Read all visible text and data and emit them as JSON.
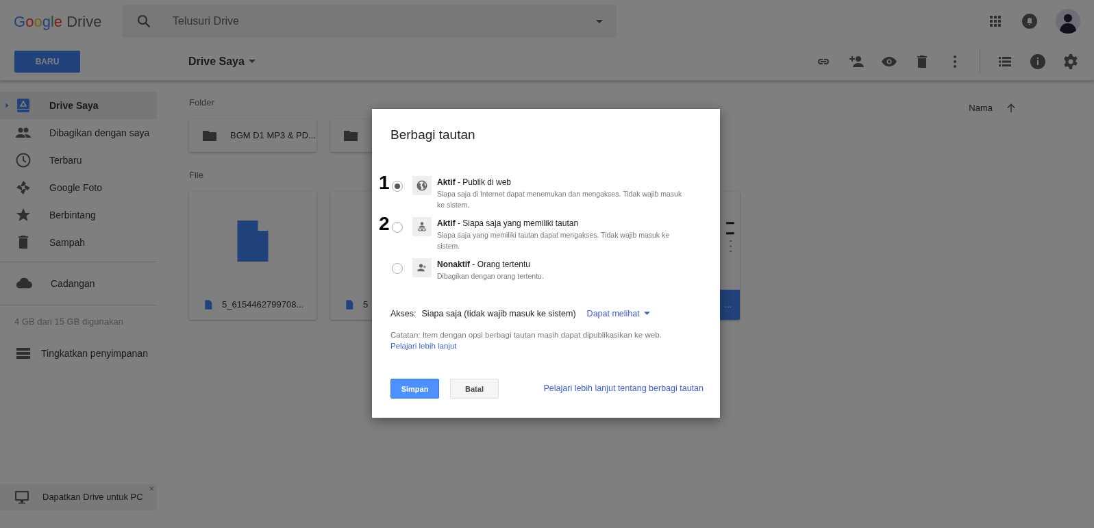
{
  "header": {
    "logo_brand": "Google",
    "logo_product": "Drive",
    "search": {
      "placeholder": "Telusuri Drive"
    }
  },
  "new_button": "BARU",
  "location": {
    "title": "Drive Saya"
  },
  "sidebar": {
    "items": [
      {
        "label": "Drive Saya",
        "selected": true
      },
      {
        "label": "Dibagikan dengan saya",
        "selected": false
      },
      {
        "label": "Terbaru",
        "selected": false
      },
      {
        "label": "Google Foto",
        "selected": false
      },
      {
        "label": "Berbintang",
        "selected": false
      },
      {
        "label": "Sampah",
        "selected": false
      }
    ],
    "backup": {
      "label": "Cadangan"
    },
    "storage": "4 GB dari 15 GB digunakan",
    "upgrade": "Tingkatkan penyimpanan"
  },
  "content": {
    "folder_heading": "Folder",
    "file_heading": "File",
    "sort": "Nama"
  },
  "folders": [
    {
      "name": "BGM D1 MP3 & PD...",
      "kind": "folder"
    },
    {
      "kind": "folder"
    }
  ],
  "files": [
    {
      "name": "5_6154462799708...",
      "kind": "doc"
    },
    {
      "name": "5",
      "kind": "doc"
    },
    {
      "name": "...",
      "kind": "sheet"
    }
  ],
  "promo": {
    "text": "Dapatkan Drive untuk PC",
    "close": "×"
  },
  "dialog": {
    "title": "Berbagi tautan",
    "options": [
      {
        "marker": "1",
        "title": "**Aktif** - Publik di web",
        "description": "Siapa saja di Internet dapat menemukan dan mengakses. Tidak wajib masuk ke sistem.",
        "selected": true
      },
      {
        "marker": "2",
        "title": "**Aktif** - Siapa saja yang memiliki tautan",
        "description": "Siapa saja yang memiliki tautan dapat mengakses. Tidak wajib masuk ke sistem.",
        "selected": false
      },
      {
        "title": "**Nonaktif** - Orang tertentu",
        "description": "Dibagikan dengan orang tertentu.",
        "selected": false
      }
    ],
    "access_label": "Akses:",
    "access_value": "Siapa saja (tidak wajib masuk ke sistem)",
    "permission": "Dapat melihat",
    "note": "Catatan: Item dengan opsi berbagi tautan masih dapat dipublikasikan ke web.",
    "note_link": "Pelajari lebih lanjut",
    "save": "Simpan",
    "cancel": "Batal",
    "help_link": "Pelajari lebih lanjut tentang berbagi tautan"
  }
}
